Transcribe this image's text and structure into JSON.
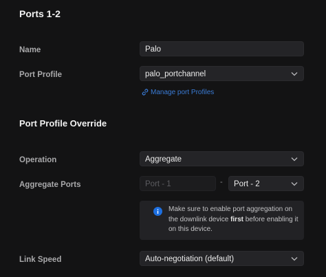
{
  "header": {
    "title": "Ports 1-2"
  },
  "form": {
    "name_label": "Name",
    "name_value": "Palo",
    "profile_label": "Port Profile",
    "profile_value": "palo_portchannel",
    "manage_link": "Manage port Profiles"
  },
  "override": {
    "title": "Port Profile Override",
    "operation_label": "Operation",
    "operation_value": "Aggregate",
    "aggregate_label": "Aggregate Ports",
    "aggregate_start": "Port - 1",
    "aggregate_separator": "-",
    "aggregate_end": "Port - 2",
    "info_part1": "Make sure to enable port aggregation on the downlink device ",
    "info_bold": "first",
    "info_part2": " before enabling it on this device.",
    "link_speed_label": "Link Speed",
    "link_speed_value": "Auto-negotiation (default)"
  },
  "colors": {
    "accent": "#3a7bd5",
    "info_icon": "#1d6fe0",
    "background": "#131314",
    "field": "#242427"
  }
}
